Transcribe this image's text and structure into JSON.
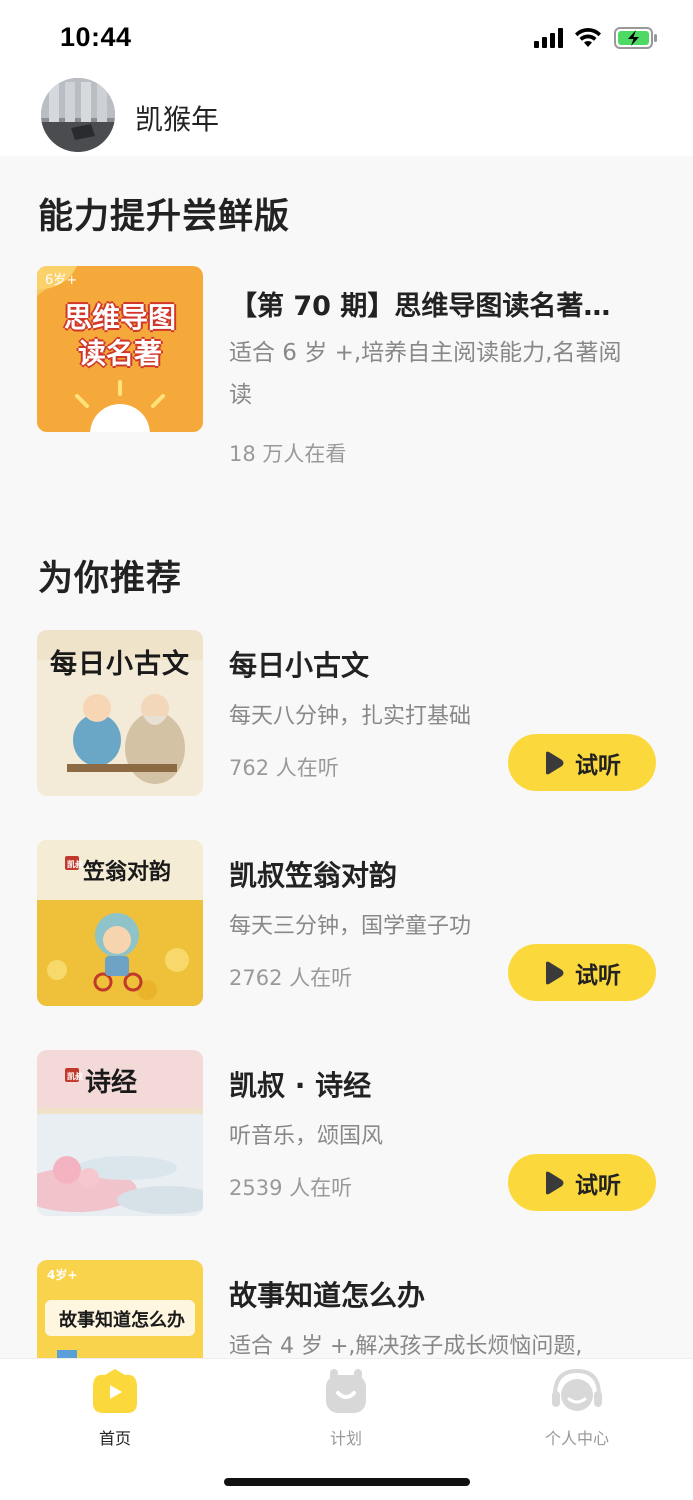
{
  "status_bar": {
    "time": "10:44"
  },
  "profile": {
    "username": "凯猴年"
  },
  "sections": {
    "featured_title": "能力提升尝鲜版",
    "recommend_title": "为你推荐"
  },
  "featured": {
    "title": "【第 70 期】思维导图读名著…",
    "description": "适合 6 岁 +,培养自主阅读能力,名著阅读",
    "views": "18 万人在看",
    "cover": {
      "age_tag": "6岁+",
      "line1": "思维导图",
      "line2": "读名著"
    }
  },
  "recommendations": [
    {
      "title": "每日小古文",
      "description": "每天八分钟，扎实打基础",
      "listeners": "762 人在听",
      "button": "试听",
      "cover_text": "每日小古文"
    },
    {
      "title": "凯叔笠翁对韵",
      "description": "每天三分钟，国学童子功",
      "listeners": "2762 人在听",
      "button": "试听",
      "cover_text": "笠翁对韵",
      "cover_badge": "凯叔"
    },
    {
      "title": "凯叔 · 诗经",
      "description": "听音乐，颂国风",
      "listeners": "2539 人在听",
      "button": "试听",
      "cover_text": "诗经",
      "cover_badge": "凯叔"
    },
    {
      "title": "故事知道怎么办",
      "description": "适合 4 岁 +,解决孩子成长烦恼问题,",
      "cover_text": "故事知道怎么办",
      "cover_tag": "4岁+"
    }
  ],
  "tabbar": {
    "tabs": [
      {
        "label": "首页",
        "icon": "home-icon",
        "active": true
      },
      {
        "label": "计划",
        "icon": "plan-icon",
        "active": false
      },
      {
        "label": "个人中心",
        "icon": "profile-icon",
        "active": false
      }
    ]
  },
  "colors": {
    "accent": "#fbd93c",
    "background": "#f8f8f8",
    "text": "#222222",
    "muted": "#888888"
  }
}
